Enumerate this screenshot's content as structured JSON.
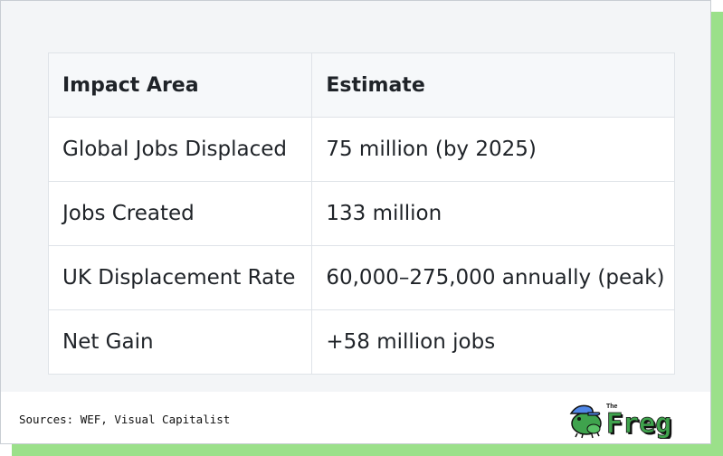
{
  "table": {
    "headers": [
      "Impact Area",
      "Estimate"
    ],
    "rows": [
      [
        "Global Jobs Displaced",
        "75 million (by 2025)"
      ],
      [
        "Jobs Created",
        "133 million"
      ],
      [
        "UK Displacement Rate",
        "60,000–275,000 annually (peak)"
      ],
      [
        "Net Gain",
        "+58 million jobs"
      ]
    ]
  },
  "footer": {
    "sources": "Sources: WEF, Visual Capitalist",
    "logo_small_text": "The",
    "logo_text": "Freg"
  },
  "colors": {
    "shadow": "#9be08a",
    "logo_green": "#3fa34d",
    "logo_blue": "#4f86e6"
  }
}
